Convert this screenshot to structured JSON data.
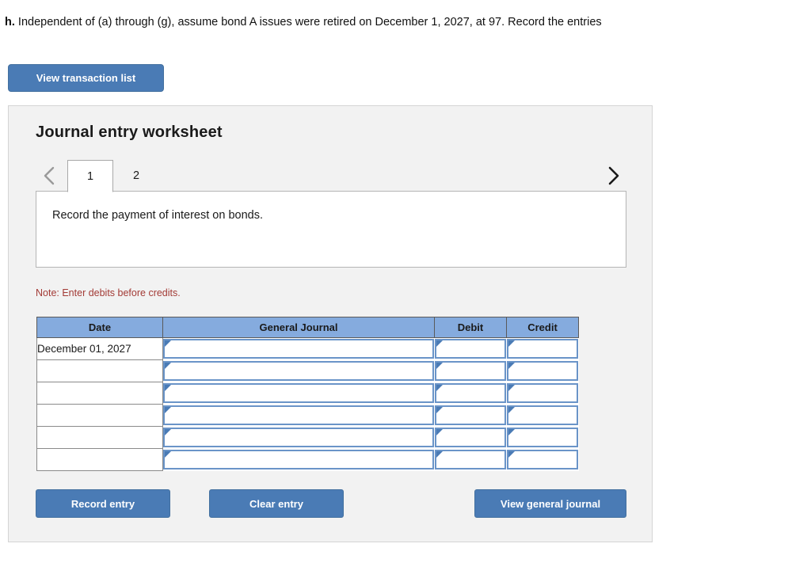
{
  "question": {
    "label": "h.",
    "text": "Independent of (a) through (g), assume bond A issues were retired on December 1, 2027, at 97. Record the entries"
  },
  "toolbar": {
    "view_transaction_list_label": "View transaction list"
  },
  "worksheet": {
    "title": "Journal entry worksheet",
    "tabs": [
      {
        "label": "1",
        "active": true
      },
      {
        "label": "2",
        "active": false
      }
    ],
    "prev_arrow_icon": "chevron-left-icon",
    "next_arrow_icon": "chevron-right-icon",
    "instruction": "Record the payment of interest on bonds.",
    "note": "Note: Enter debits before credits."
  },
  "table": {
    "columns": [
      "Date",
      "General Journal",
      "Debit",
      "Credit"
    ],
    "rows": [
      {
        "date": "December 01, 2027",
        "general_journal": "",
        "debit": "",
        "credit": ""
      },
      {
        "date": "",
        "general_journal": "",
        "debit": "",
        "credit": ""
      },
      {
        "date": "",
        "general_journal": "",
        "debit": "",
        "credit": ""
      },
      {
        "date": "",
        "general_journal": "",
        "debit": "",
        "credit": ""
      },
      {
        "date": "",
        "general_journal": "",
        "debit": "",
        "credit": ""
      },
      {
        "date": "",
        "general_journal": "",
        "debit": "",
        "credit": ""
      }
    ]
  },
  "actions": {
    "record_entry_label": "Record entry",
    "clear_entry_label": "Clear entry",
    "view_general_journal_label": "View general journal"
  },
  "colors": {
    "button_blue": "#4a7bb5",
    "table_header_blue": "#85abde",
    "note_red": "#a33b36",
    "panel_gray": "#f2f2f2"
  }
}
